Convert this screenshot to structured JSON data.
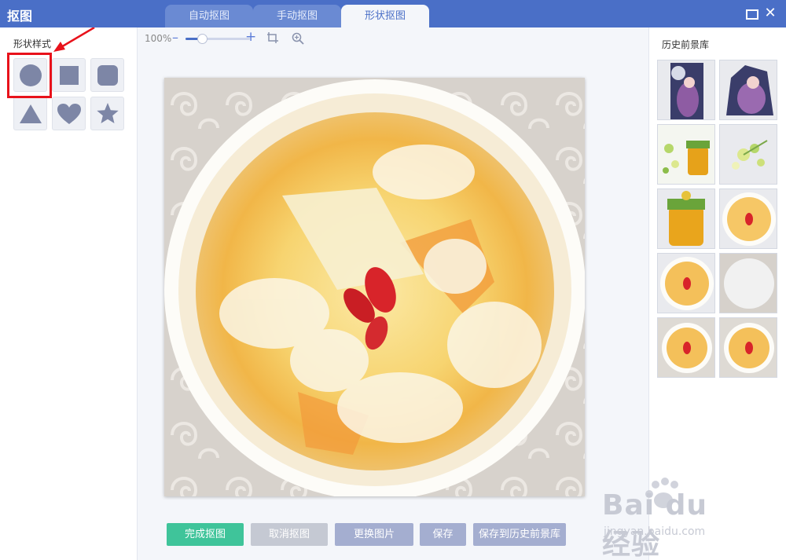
{
  "app": {
    "title": "抠图",
    "tabs": [
      {
        "label": "自动抠图",
        "active": false
      },
      {
        "label": "手动抠图",
        "active": false
      },
      {
        "label": "形状抠图",
        "active": true
      }
    ]
  },
  "left_panel": {
    "title": "形状样式",
    "shapes": [
      {
        "name": "circle",
        "icon": "circle-icon",
        "selected": true
      },
      {
        "name": "square",
        "icon": "square-icon"
      },
      {
        "name": "rounded-square",
        "icon": "rounded-square-icon"
      },
      {
        "name": "triangle",
        "icon": "triangle-icon"
      },
      {
        "name": "heart",
        "icon": "heart-icon"
      },
      {
        "name": "star",
        "icon": "star-icon"
      }
    ]
  },
  "toolbar": {
    "zoom_label": "100%",
    "zoom_level": 0.25,
    "icons": [
      "zoom-out-icon",
      "zoom-in-icon",
      "crop-icon",
      "fit-zoom-icon"
    ]
  },
  "actions": {
    "finish": "完成抠图",
    "cancel": "取消抠图",
    "replace": "更换图片",
    "save": "保存",
    "save_history": "保存到历史前景库"
  },
  "right_panel": {
    "title": "历史前景库",
    "thumbnails": [
      "anime-figures",
      "anime-figures-cutout",
      "honey-jar-flowers",
      "flowers-cutout",
      "honey-jar",
      "soup-bowl-cutout",
      "soup-bowl",
      "white-circle",
      "soup-bowl-square",
      "soup-bowl-square-2"
    ]
  },
  "watermark": {
    "text": "Bai du 经验",
    "sub": "jingyan.baidu.com"
  },
  "colors": {
    "titlebar": "#4a6fc7",
    "shape_icon": "#7d86a6",
    "highlight": "#e8121b",
    "finish_button": "#3fc49a"
  }
}
